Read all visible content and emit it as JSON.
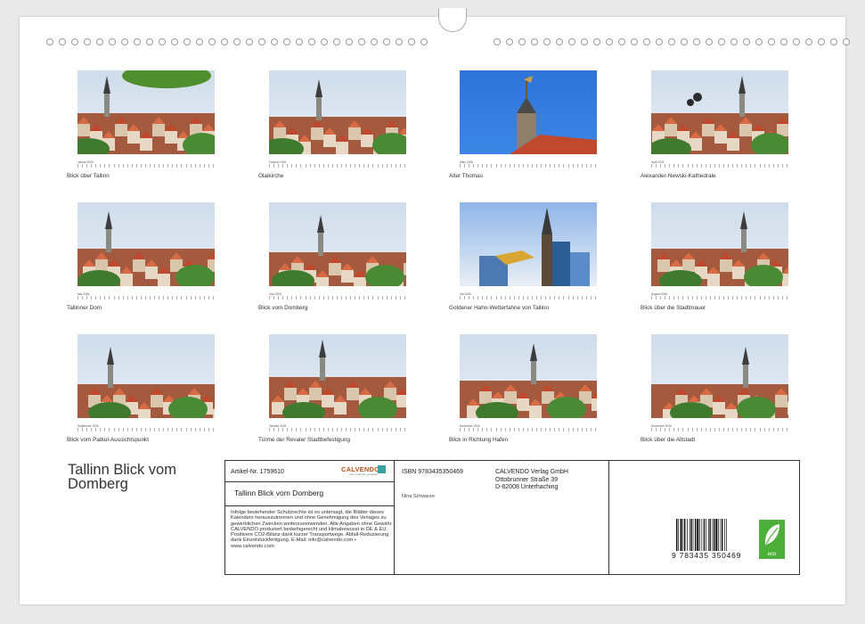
{
  "calendar": {
    "title_line1": "Tallinn Blick vom",
    "title_line2": "Domberg",
    "months": [
      {
        "label": "Januar 2026",
        "caption": "Blick über Tallinn"
      },
      {
        "label": "Februar 2026",
        "caption": "Olaikirche"
      },
      {
        "label": "März 2026",
        "caption": "Alter Thomas"
      },
      {
        "label": "April 2026",
        "caption": "Alexander-Newski-Kathedrale"
      },
      {
        "label": "Mai 2026",
        "caption": "Tallinner Dom"
      },
      {
        "label": "Juni 2026",
        "caption": "Blick vom Domberg"
      },
      {
        "label": "Juli 2026",
        "caption": "Goldener Hahn-Wetterfahne von Tallinn"
      },
      {
        "label": "August 2026",
        "caption": "Blick über die Stadtmauer"
      },
      {
        "label": "September 2026",
        "caption": "Blick vom Patkul-Aussichtspunkt"
      },
      {
        "label": "Oktober 2026",
        "caption": "Türme der Revaler Stadtbefestigung"
      },
      {
        "label": "November 2026",
        "caption": "Blick in Richtung Hafen"
      },
      {
        "label": "Dezember 2026",
        "caption": "Blick über die Altstadt"
      }
    ]
  },
  "info": {
    "article": "Artikel-Nr. 1759610",
    "publisher_logo": "CALVENDO",
    "publisher_logo_sub": "Jetzt Kalender gestalten",
    "subtitle": "Tallinn Blick vom Domberg",
    "legal": "Infolge bestehender Schutzrechte ist es untersagt, die Blätter dieses Kalenders herauszutrennen und ohne Genehmigung des Verlages zu gewerblichen Zwecken weiterzuverwenden. Alle Angaben ohne Gewähr. CALVENDO produziert bedarfsgerecht und klimabewusst in DE & EU. Positivere CO2-Bilanz dank kurzer Transportwege. Abfall-Reduzierung dank Einzelstückfertigung. E-Mail: info@calvendo.com • www.calvendo.com",
    "isbn": "ISBN 9783435350469",
    "publisher_name": "CALVENDO Verlag GmbH",
    "publisher_street": "Ottobrunner Straße 39",
    "publisher_city": "D-82008 Unterhaching",
    "author": "Nina Schwarze",
    "barcode_digits": "9 783435 350469",
    "eco_label": "eco"
  },
  "colors": {
    "sky": "#a9c7e6",
    "roof": "#c0482d",
    "tree": "#3f7a2f",
    "blue_sky": "#2f74d8"
  }
}
